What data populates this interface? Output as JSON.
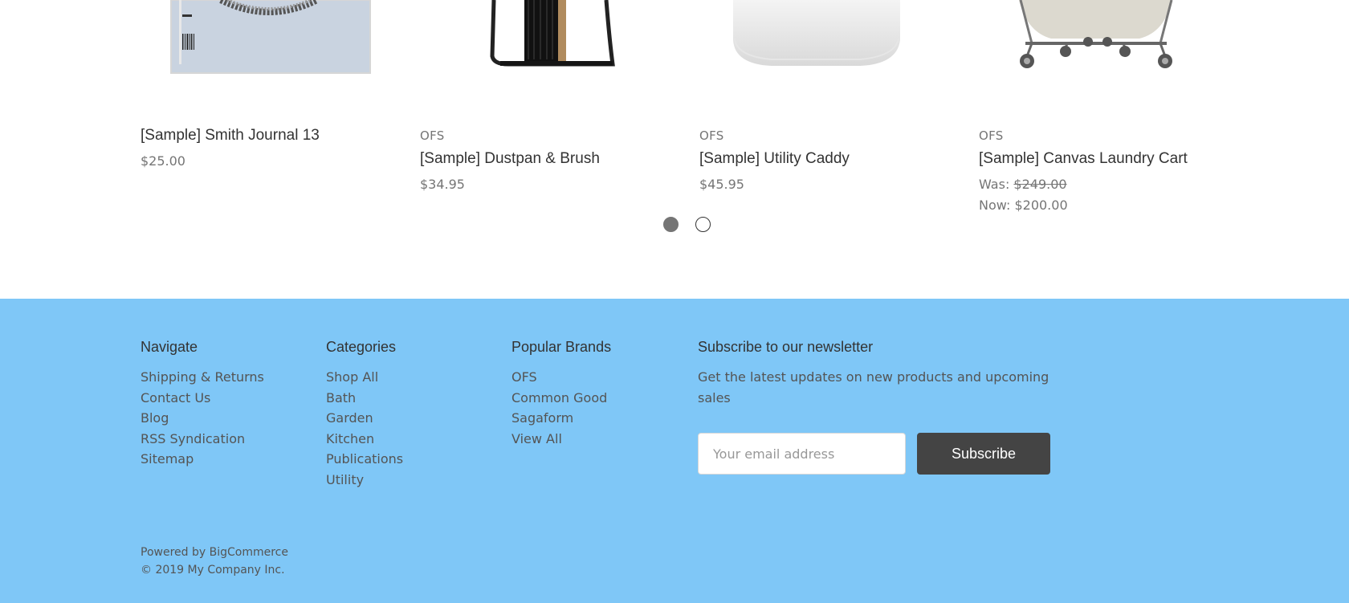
{
  "products": [
    {
      "brand": "",
      "name": "[Sample] Smith Journal 13",
      "price": "$25.00",
      "image": "magazine-cover-image"
    },
    {
      "brand": "OFS",
      "name": "[Sample] Dustpan & Brush",
      "price": "$34.95",
      "image": "dustpan-brush-image"
    },
    {
      "brand": "OFS",
      "name": "[Sample] Utility Caddy",
      "price": "$45.95",
      "image": "utility-caddy-image"
    },
    {
      "brand": "OFS",
      "name": "[Sample] Canvas Laundry Cart",
      "was_label": "Was:",
      "was_price": "$249.00",
      "now_label": "Now:",
      "now_price": "$200.00",
      "image": "laundry-cart-image"
    }
  ],
  "carousel": {
    "pages": 2,
    "active_page": 1
  },
  "footer": {
    "navigate": {
      "heading": "Navigate",
      "links": [
        "Shipping & Returns",
        "Contact Us",
        "Blog",
        "RSS Syndication",
        "Sitemap"
      ]
    },
    "categories": {
      "heading": "Categories",
      "links": [
        "Shop All",
        "Bath",
        "Garden",
        "Kitchen",
        "Publications",
        "Utility"
      ]
    },
    "brands": {
      "heading": "Popular Brands",
      "links": [
        "OFS",
        "Common Good",
        "Sagaform",
        "View All"
      ]
    },
    "newsletter": {
      "heading": "Subscribe to our newsletter",
      "lead": "Get the latest updates on new products and upcoming sales",
      "email_placeholder": "Your email address",
      "email_value": "",
      "button_label": "Subscribe"
    },
    "powered_by": "Powered by BigCommerce",
    "copyright": "© 2019 My Company Inc."
  },
  "colors": {
    "footer_bg": "#7fc7f7",
    "button_bg": "#444444",
    "text_muted": "#757575"
  }
}
